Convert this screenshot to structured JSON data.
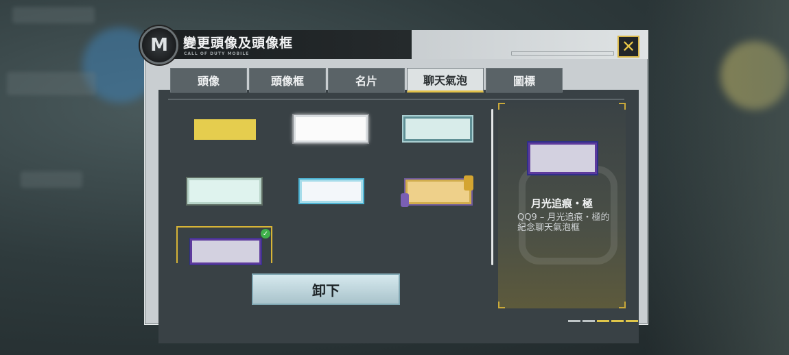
{
  "dialog": {
    "title": "變更頭像及頭像框",
    "subtitle": "CALL OF DUTY MOBILE",
    "logo_letter": "M",
    "close_icon": "close-icon"
  },
  "tabs": [
    {
      "label": "頭像",
      "active": false
    },
    {
      "label": "頭像框",
      "active": false
    },
    {
      "label": "名片",
      "active": false
    },
    {
      "label": "聊天氣泡",
      "active": true
    },
    {
      "label": "圖標",
      "active": false
    }
  ],
  "items": [
    {
      "id": "bubble-1",
      "style": "plain-yellow"
    },
    {
      "id": "bubble-2",
      "style": "white-ornate"
    },
    {
      "id": "bubble-3",
      "style": "teal-frame"
    },
    {
      "id": "bubble-4",
      "style": "mint-ornate"
    },
    {
      "id": "bubble-5",
      "style": "ice-blue"
    },
    {
      "id": "bubble-6",
      "style": "gold-gamepad"
    },
    {
      "id": "bubble-7",
      "style": "moonlight",
      "selected": true,
      "equipped": true
    }
  ],
  "actions": {
    "unequip_label": "卸下"
  },
  "detail": {
    "name": "月光追痕・極",
    "description": "QQ9 – 月光追痕・極的紀念聊天氣泡框"
  },
  "colors": {
    "accent_gold": "#d7b437",
    "equipped_check": "#3fb04a",
    "panel_dark": "#394145"
  }
}
